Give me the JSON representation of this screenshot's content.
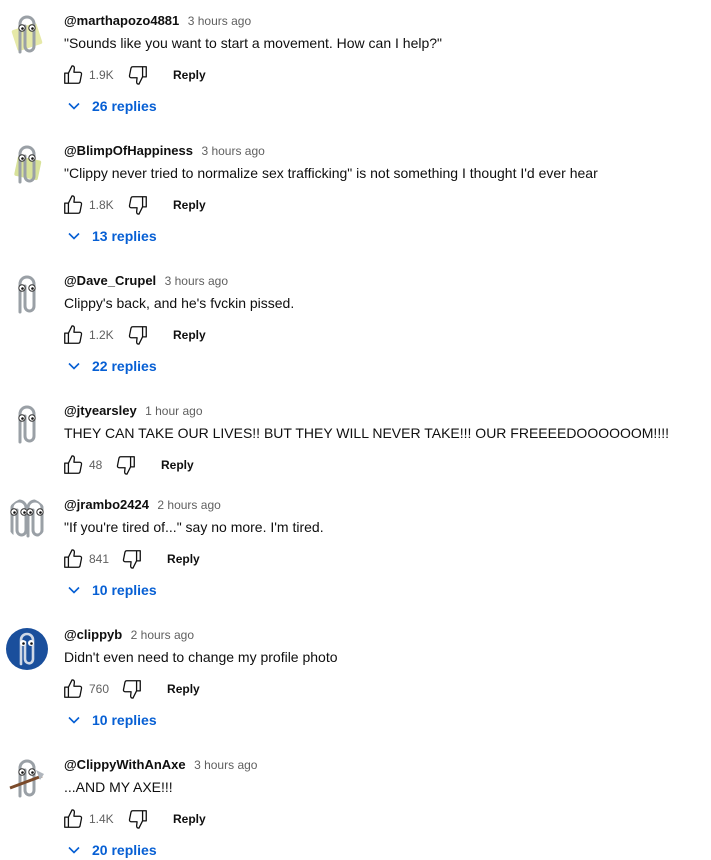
{
  "comments": [
    {
      "author": "@marthapozo4881",
      "time": "3 hours ago",
      "text": "\"Sounds like you want to start a movement. How can I help?\"",
      "likes": "1.9K",
      "reply_label": "Reply",
      "replies": "26 replies"
    },
    {
      "author": "@BlimpOfHappiness",
      "time": "3 hours ago",
      "text": "\"Clippy never tried to normalize sex trafficking\" is not something I thought I'd ever hear",
      "likes": "1.8K",
      "reply_label": "Reply",
      "replies": "13 replies"
    },
    {
      "author": "@Dave_Crupel",
      "time": "3 hours ago",
      "text": "Clippy's back, and he's fvckin pissed.",
      "likes": "1.2K",
      "reply_label": "Reply",
      "replies": "22 replies"
    },
    {
      "author": "@jtyearsley",
      "time": "1 hour ago",
      "text": "THEY CAN TAKE OUR LIVES!!  BUT THEY WILL NEVER TAKE!!!  OUR FREEEEDOOOOOOM!!!!",
      "likes": "48",
      "reply_label": "Reply",
      "replies": ""
    },
    {
      "author": "@jrambo2424",
      "time": "2 hours ago",
      "text": "\"If you're tired of...\" say no more.  I'm tired.",
      "likes": "841",
      "reply_label": "Reply",
      "replies": "10 replies"
    },
    {
      "author": "@clippyb",
      "time": "2 hours ago",
      "text": "Didn't even need to change my profile photo",
      "likes": "760",
      "reply_label": "Reply",
      "replies": "10 replies"
    },
    {
      "author": "@ClippyWithAnAxe",
      "time": "3 hours ago",
      "text": "...AND MY AXE!!!",
      "likes": "1.4K",
      "reply_label": "Reply",
      "replies": "20 replies"
    }
  ],
  "colors": {
    "link": "#065fd4",
    "meta": "#606060",
    "text": "#0f0f0f"
  },
  "icons": {
    "like": "thumb-up-outline-icon",
    "dislike": "thumb-down-outline-icon",
    "chevron": "chevron-down-icon",
    "avatar": "clippy-paperclip-avatar"
  }
}
